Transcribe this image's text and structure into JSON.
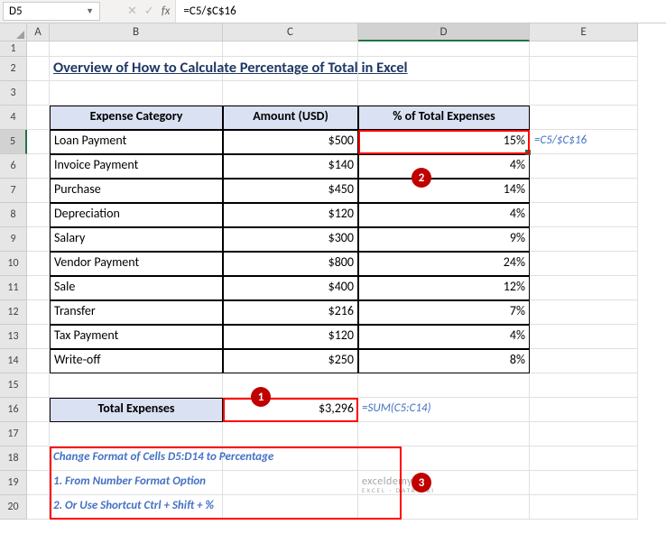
{
  "nameBox": "D5",
  "formulaBar": "=C5/$C$16",
  "columns": [
    "A",
    "B",
    "C",
    "D",
    "E"
  ],
  "rows": [
    "1",
    "2",
    "3",
    "4",
    "5",
    "6",
    "7",
    "8",
    "9",
    "10",
    "11",
    "12",
    "13",
    "14",
    "15",
    "16",
    "17",
    "18",
    "19",
    "20"
  ],
  "selectedRow": "5",
  "selectedCol": "D",
  "title": "Overview of How to Calculate Percentage of Total in Excel",
  "headers": {
    "b": "Expense Category",
    "c": "Amount (USD)",
    "d": "% of Total Expenses"
  },
  "data": [
    {
      "cat": "Loan Payment",
      "amt": "$500",
      "pct": "15%"
    },
    {
      "cat": "Invoice Payment",
      "amt": "$140",
      "pct": "4%"
    },
    {
      "cat": "Purchase",
      "amt": "$450",
      "pct": "14%"
    },
    {
      "cat": "Depreciation",
      "amt": "$120",
      "pct": "4%"
    },
    {
      "cat": "Salary",
      "amt": "$300",
      "pct": "9%"
    },
    {
      "cat": "Vendor Payment",
      "amt": "$800",
      "pct": "24%"
    },
    {
      "cat": "Sale",
      "amt": "$400",
      "pct": "12%"
    },
    {
      "cat": "Transfer",
      "amt": "$216",
      "pct": "7%"
    },
    {
      "cat": "Tax Payment",
      "amt": "$120",
      "pct": "4%"
    },
    {
      "cat": "Write-off",
      "amt": "$250",
      "pct": "8%"
    }
  ],
  "totalLabel": "Total Expenses",
  "totalValue": "$3,296",
  "totalFormula": "=SUM(C5:C14)",
  "d5Formula": "=C5/$C$16",
  "notes": {
    "l1": "Change Format of Cells D5:D14 to Percentage",
    "l2": "1. From Number Format Option",
    "l3": "2. Or Use Shortcut Ctrl + Shift + %"
  },
  "watermark": {
    "big": "exceldemy",
    "small": "EXCEL · DATA · BI"
  },
  "badges": {
    "b1": "1",
    "b2": "2",
    "b3": "3"
  }
}
